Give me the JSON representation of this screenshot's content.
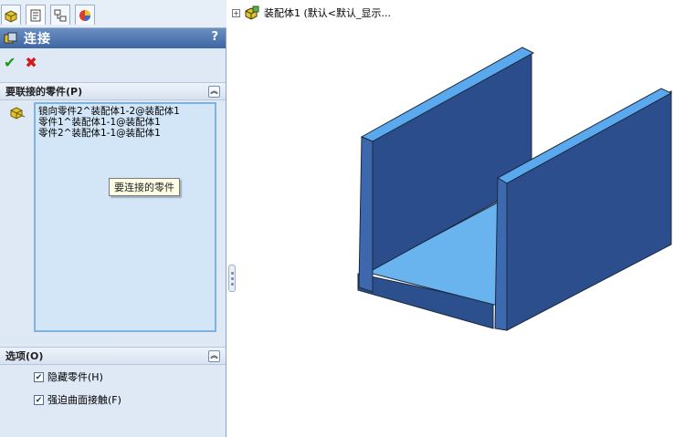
{
  "feature_panel": {
    "tabs": [
      {
        "icon": "feature-manager-icon"
      },
      {
        "icon": "property-manager-icon"
      },
      {
        "icon": "configuration-manager-icon"
      },
      {
        "icon": "display-manager-icon"
      }
    ],
    "title": "连接",
    "help": "?",
    "components_group": {
      "header": "要联接的零件(P)",
      "items": [
        "镜向零件2^装配体1-2@装配体1",
        "零件1^装配体1-1@装配体1",
        "零件2^装配体1-1@装配体1"
      ],
      "tooltip": "要连接的零件"
    },
    "options_group": {
      "header": "选项(O)",
      "options": [
        {
          "label": "隐藏零件(H)",
          "checked": true
        },
        {
          "label": "强迫曲面接触(F)",
          "checked": true
        }
      ]
    }
  },
  "graphics_area": {
    "tree_root_label": "装配体1 (默认<默认_显示..."
  },
  "colors": {
    "model_face": "#2d4e8c",
    "model_top": "#5aa9ee",
    "model_side": "#3d69b0",
    "floor": "#6ab6ef"
  }
}
